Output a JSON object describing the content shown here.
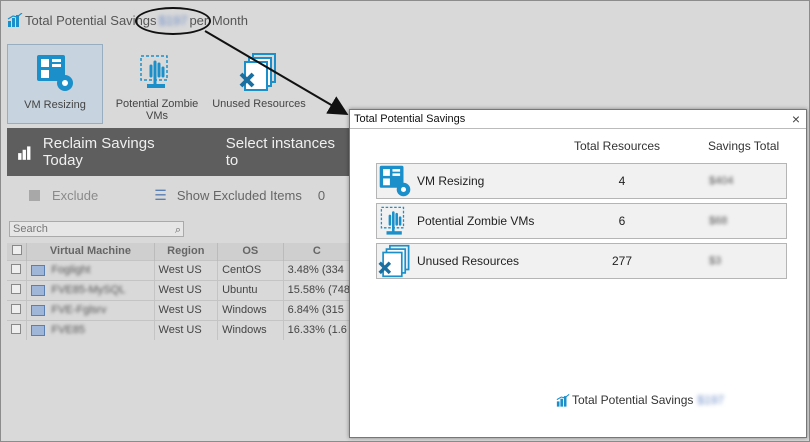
{
  "header": {
    "title_prefix": "Total Potential Savings",
    "amount": "$197",
    "suffix": "per Month"
  },
  "tiles": [
    {
      "label": "VM Resizing",
      "icon": "vm-resizing-icon",
      "active": true
    },
    {
      "label": "Potential Zombie VMs",
      "icon": "zombie-vm-icon",
      "active": false
    },
    {
      "label": "Unused Resources",
      "icon": "unused-resources-icon",
      "active": false
    }
  ],
  "reclaim_bar": {
    "title": "Reclaim Savings Today",
    "hint": "Select instances to"
  },
  "toolbar": {
    "exclude_label": "Exclude",
    "show_excluded_label": "Show Excluded Items",
    "excluded_count": "0"
  },
  "search": {
    "placeholder": "Search"
  },
  "grid": {
    "columns": [
      "Virtual Machine",
      "Region",
      "OS",
      "C"
    ],
    "rows": [
      {
        "vm": "Foglight",
        "region": "West US",
        "os": "CentOS",
        "c": "3.48% (334"
      },
      {
        "vm": "FVE85-MySQL",
        "region": "West US",
        "os": "Ubuntu",
        "c": "15.58% (748"
      },
      {
        "vm": "FVE-Fglsrv",
        "region": "West US",
        "os": "Windows",
        "c": "6.84% (315"
      },
      {
        "vm": "FVE85",
        "region": "West US",
        "os": "Windows",
        "c": "16.33% (1.6"
      }
    ]
  },
  "popup": {
    "title": "Total Potential Savings",
    "close": "×",
    "col_total_resources": "Total Resources",
    "col_savings_total": "Savings Total",
    "rows": [
      {
        "name": "VM Resizing",
        "count": "4",
        "savings": "$404",
        "icon": "vm-resizing-icon"
      },
      {
        "name": "Potential Zombie VMs",
        "count": "6",
        "savings": "$68",
        "icon": "zombie-vm-icon"
      },
      {
        "name": "Unused Resources",
        "count": "277",
        "savings": "$3",
        "icon": "unused-resources-icon"
      }
    ],
    "footer_label": "Total Potential Savings",
    "footer_amount": "$197"
  },
  "colors": {
    "accent": "#1a8fc9",
    "bar_dark": "#5e5e5e",
    "link_blue": "#6b8cc7"
  }
}
